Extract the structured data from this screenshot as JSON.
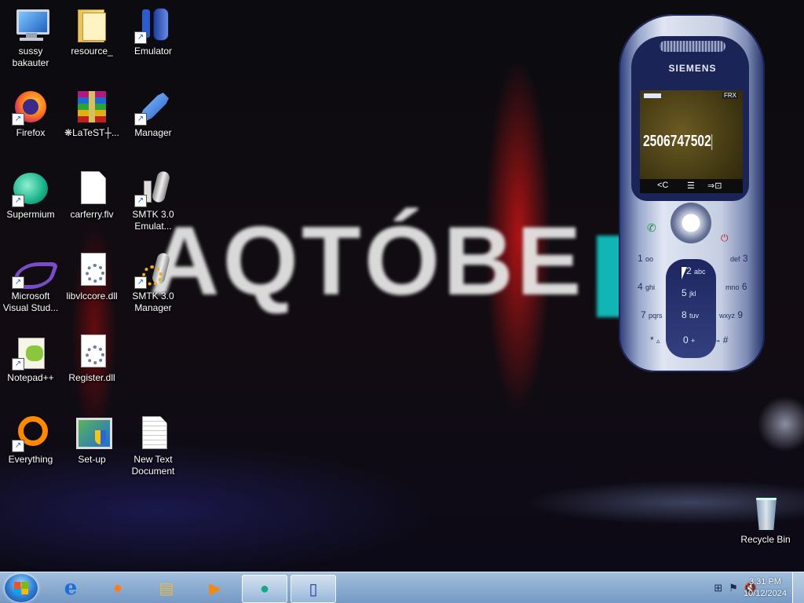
{
  "wallpaper": {
    "text": "AQTÓBE"
  },
  "desktop_icons": [
    {
      "label": "sussy bakauter",
      "icon": "computer-icon"
    },
    {
      "label": "resource_",
      "icon": "folder-icon"
    },
    {
      "label": "Emulator",
      "icon": "phone-emulator-icon"
    },
    {
      "label": "Firefox",
      "icon": "firefox-icon"
    },
    {
      "label": "❋LaTeST┼...",
      "icon": "winrar-icon"
    },
    {
      "label": "Manager",
      "icon": "manager-icon"
    },
    {
      "label": "Supermium",
      "icon": "supermium-icon"
    },
    {
      "label": "carferry.flv",
      "icon": "file-icon"
    },
    {
      "label": "SMTK 3.0 Emulat...",
      "icon": "smtk-emulator-icon"
    },
    {
      "label": "Microsoft Visual Stud...",
      "icon": "visual-studio-icon"
    },
    {
      "label": "libvlccore.dll",
      "icon": "dll-icon"
    },
    {
      "label": "SMTK 3.0 Manager",
      "icon": "smtk-manager-icon"
    },
    {
      "label": "Notepad++",
      "icon": "notepadpp-icon"
    },
    {
      "label": "Register.dll",
      "icon": "dll-icon"
    },
    {
      "label": "Everything",
      "icon": "everything-icon"
    },
    {
      "label": "Set-up",
      "icon": "setup-icon"
    },
    {
      "label": "New Text Document",
      "icon": "text-document-icon"
    },
    {
      "label": "Recycle Bin",
      "icon": "recycle-bin-icon"
    }
  ],
  "phone": {
    "brand": "SIEMENS",
    "battery": "FRX",
    "number": "2506747502",
    "softkeys": {
      "left": "<C",
      "menu": "☰",
      "right": "⇒⊡"
    },
    "keys": [
      {
        "num": "1",
        "letters": "oo"
      },
      {
        "num": "2",
        "letters": "abc"
      },
      {
        "num": "3",
        "letters": "def"
      },
      {
        "num": "4",
        "letters": "ghi"
      },
      {
        "num": "5",
        "letters": "jkl"
      },
      {
        "num": "6",
        "letters": "mno"
      },
      {
        "num": "7",
        "letters": "pqrs"
      },
      {
        "num": "8",
        "letters": "tuv"
      },
      {
        "num": "9",
        "letters": "wxyz"
      },
      {
        "num": "*",
        "letters": "▵"
      },
      {
        "num": "0",
        "letters": "+"
      },
      {
        "num": "#",
        "letters": "⌁"
      }
    ]
  },
  "taskbar": {
    "items": [
      {
        "name": "internet-explorer-icon",
        "glyph": "e"
      },
      {
        "name": "firefox-icon",
        "glyph": "●"
      },
      {
        "name": "file-explorer-icon",
        "glyph": "▤"
      },
      {
        "name": "media-player-icon",
        "glyph": "▶"
      },
      {
        "name": "supermium-icon",
        "glyph": "●"
      },
      {
        "name": "emulator-icon",
        "glyph": "▯"
      }
    ],
    "clock": {
      "time": "3:31 PM",
      "date": "10/12/2024"
    }
  }
}
